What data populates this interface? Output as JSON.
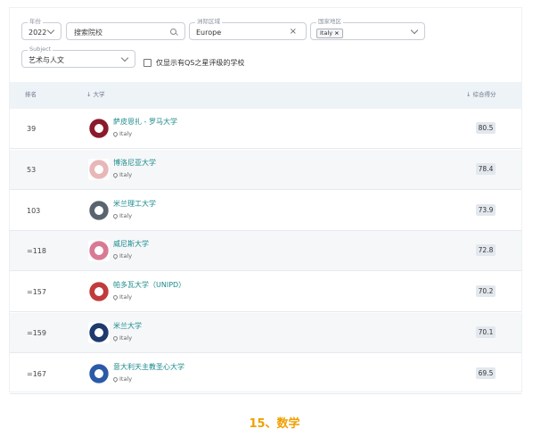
{
  "filters": {
    "year": {
      "label": "年份",
      "value": "2022"
    },
    "search": {
      "placeholder": "搜索院校"
    },
    "region": {
      "label": "洲际区域",
      "value": "Europe"
    },
    "country": {
      "label": "国家地区",
      "chip": "Italy",
      "chip_remove": "×"
    },
    "subject": {
      "label": "Subject",
      "value": "艺术与人文"
    },
    "qs_only": {
      "label": "仅显示有QS之星评级的学校",
      "checked": false
    }
  },
  "table": {
    "headers": {
      "rank": "排名",
      "university": "↓ 大学",
      "score": "↓ 综合得分"
    },
    "rows": [
      {
        "rank": "39",
        "name": "萨皮恩扎 - 罗马大学",
        "location": "Italy",
        "score": "80.5",
        "logo": "sapienza-seal-icon",
        "color": "#8b1a2b"
      },
      {
        "rank": "53",
        "name": "博洛尼亚大学",
        "location": "Italy",
        "score": "78.4",
        "logo": "bologna-seal-icon",
        "color": "#e8b7b7"
      },
      {
        "rank": "103",
        "name": "米兰理工大学",
        "location": "Italy",
        "score": "73.9",
        "logo": "polimi-seal-icon",
        "color": "#5a6470"
      },
      {
        "rank": "=118",
        "name": "威尼斯大学",
        "location": "Italy",
        "score": "72.8",
        "logo": "venice-seal-icon",
        "color": "#d97a95"
      },
      {
        "rank": "=157",
        "name": "帕多瓦大学（UNIPD）",
        "location": "Italy",
        "score": "70.2",
        "logo": "padova-seal-icon",
        "color": "#c23b3b"
      },
      {
        "rank": "=159",
        "name": "米兰大学",
        "location": "Italy",
        "score": "70.1",
        "logo": "milan-seal-icon",
        "color": "#1e3a6e"
      },
      {
        "rank": "=167",
        "name": "意大利天主教圣心大学",
        "location": "Italy",
        "score": "69.5",
        "logo": "cattolica-seal-icon",
        "color": "#2a5aa8"
      }
    ]
  },
  "section_title": "15、数学"
}
